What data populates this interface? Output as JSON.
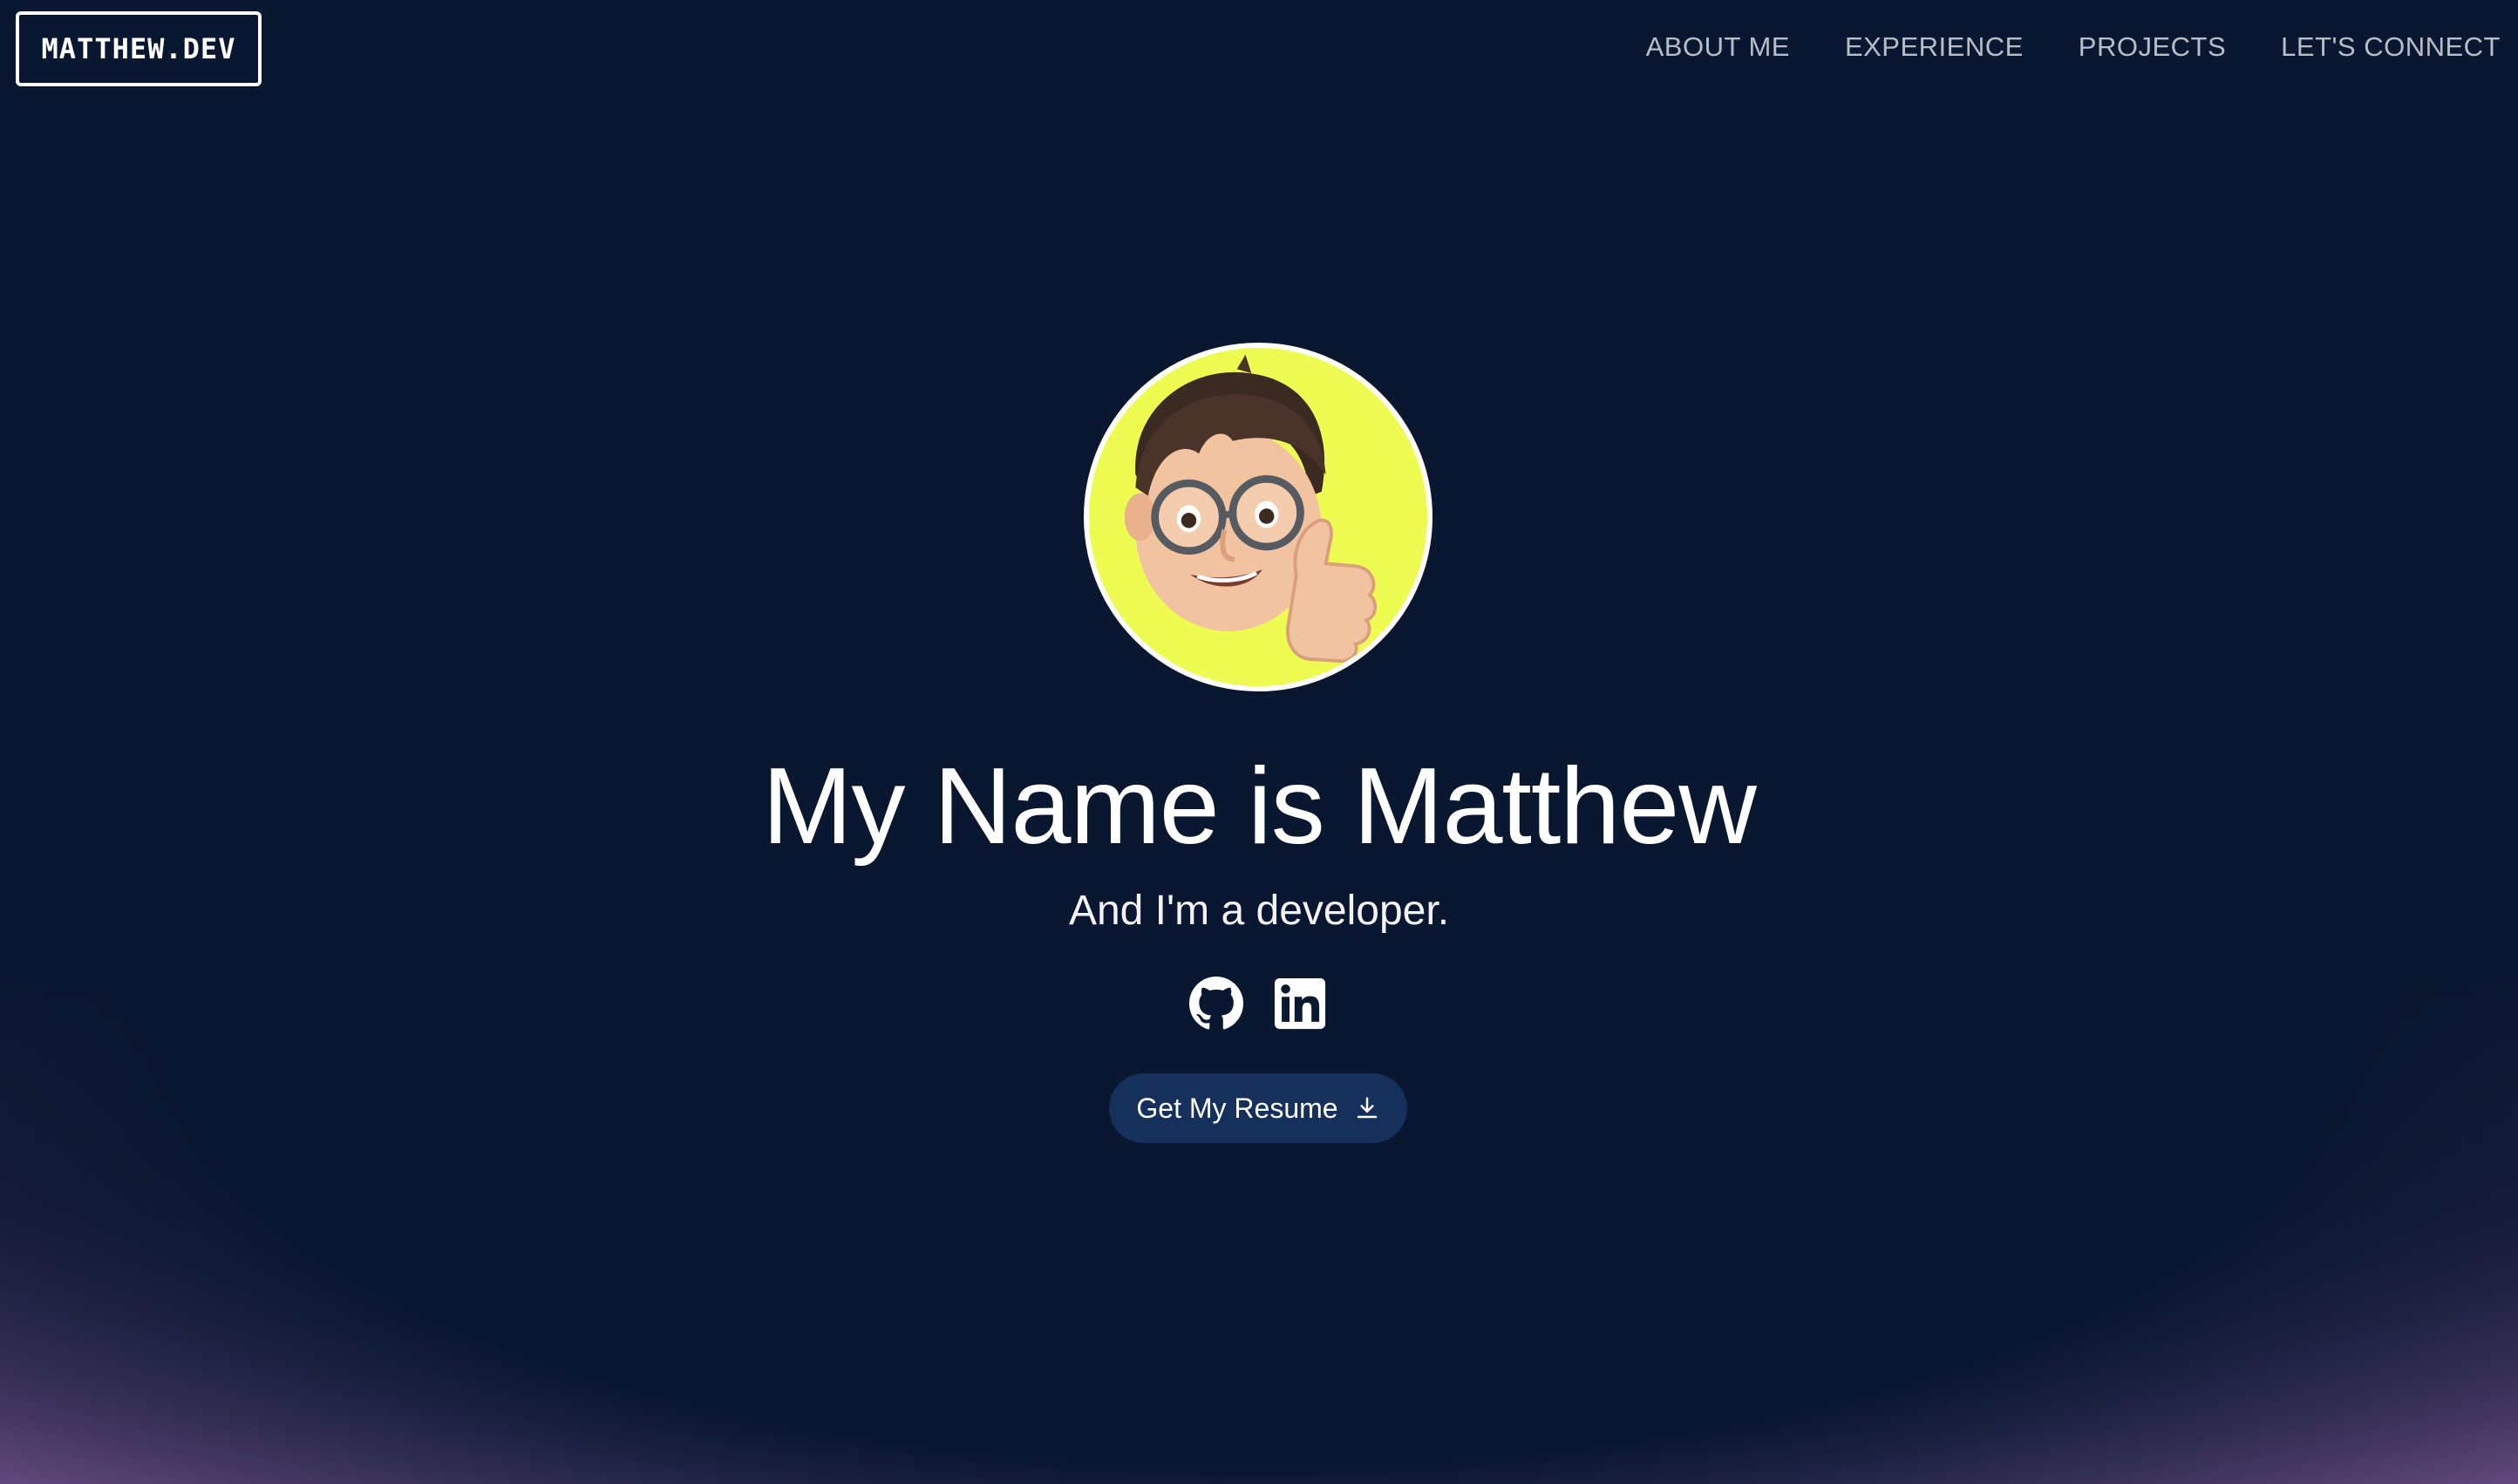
{
  "header": {
    "logo": "MATTHEW.DEV",
    "nav": [
      "ABOUT ME",
      "EXPERIENCE",
      "PROJECTS",
      "LET'S CONNECT"
    ]
  },
  "hero": {
    "avatar_icon": "memoji-avatar-thumbs-up",
    "title": "My Name is Matthew",
    "subtitle": "And I'm a developer.",
    "socials": [
      {
        "icon": "github-icon"
      },
      {
        "icon": "linkedin-icon"
      }
    ],
    "resume_button": {
      "label": "Get My Resume",
      "icon": "download-icon"
    }
  },
  "colors": {
    "background": "#0a1730",
    "glow": "#7a5690",
    "avatar_bg": "#eefc52",
    "button_bg": "#15305a",
    "nav_text": "#b8bec9"
  }
}
